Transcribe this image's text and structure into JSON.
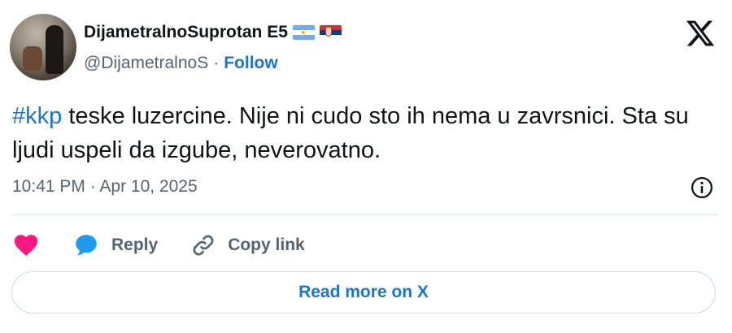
{
  "author": {
    "display_name": "DijametralnoSuprotan E5",
    "flags": [
      "argentina-flag",
      "serbia-flag"
    ],
    "handle": "@DijametralnoS",
    "separator": "·",
    "follow_label": "Follow"
  },
  "tweet": {
    "hashtag": "#kkp",
    "text": " teske luzercine. Nije ni cudo sto ih nema u zavrsnici. Sta su ljudi uspeli da izgube, neverovatno.",
    "timestamp": "10:41 PM · Apr 10, 2025"
  },
  "actions": {
    "like_icon": "heart-icon",
    "reply_label": "Reply",
    "copy_label": "Copy link"
  },
  "footer": {
    "read_more_label": "Read more on X"
  },
  "colors": {
    "link_blue": "#1d75c8",
    "heart_red": "#f91880",
    "reply_blue": "#1d9bf0",
    "text_gray": "#536471",
    "border": "#cfd9de"
  }
}
